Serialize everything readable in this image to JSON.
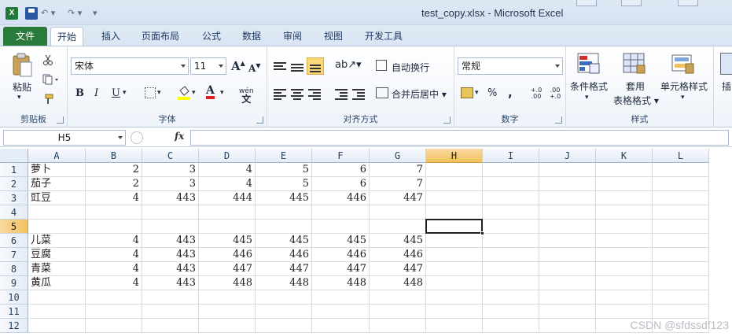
{
  "window": {
    "title": "test_copy.xlsx  -  Microsoft Excel"
  },
  "qat": {
    "undo": "↶ ▾",
    "redo": "↷ ▾",
    "customize": "▾"
  },
  "tabs": [
    {
      "label": "文件"
    },
    {
      "label": "开始"
    },
    {
      "label": "插入"
    },
    {
      "label": "页面布局"
    },
    {
      "label": "公式"
    },
    {
      "label": "数据"
    },
    {
      "label": "审阅"
    },
    {
      "label": "视图"
    },
    {
      "label": "开发工具"
    }
  ],
  "ribbon": {
    "clipboard": {
      "label": "剪贴板",
      "paste": "粘贴"
    },
    "font": {
      "label": "字体",
      "name": "宋体",
      "size": "11",
      "grow": "A",
      "shrink": "A",
      "bold": "B",
      "italic": "I",
      "underline": "U",
      "font_color": "A",
      "phonetic": "wén"
    },
    "alignment": {
      "label": "对齐方式",
      "wrap": "自动换行",
      "merge": "合并后居中"
    },
    "number": {
      "label": "数字",
      "format": "常规",
      "percent": "%",
      "comma": ",",
      "inc_decimal": "+.0 .00",
      "dec_decimal": ".00 +.0"
    },
    "styles": {
      "label": "样式",
      "cond_format": "条件格式",
      "table_format_1": "套用",
      "table_format_2": "表格格式",
      "cell_styles": "单元格样式",
      "insert_partial": "插"
    }
  },
  "formula_bar": {
    "name_box": "H5",
    "fx": "fx",
    "formula": ""
  },
  "sheet": {
    "columns": [
      "A",
      "B",
      "C",
      "D",
      "E",
      "F",
      "G",
      "H",
      "I",
      "J",
      "K",
      "L"
    ],
    "selected_column": "H",
    "selected_row": 5,
    "rows": [
      {
        "n": 1,
        "cells": [
          "萝卜",
          2,
          3,
          4,
          5,
          6,
          7
        ]
      },
      {
        "n": 2,
        "cells": [
          "茄子",
          2,
          3,
          4,
          5,
          6,
          7
        ]
      },
      {
        "n": 3,
        "cells": [
          "豇豆",
          4,
          443,
          444,
          445,
          446,
          447
        ]
      },
      {
        "n": 4,
        "cells": []
      },
      {
        "n": 5,
        "cells": []
      },
      {
        "n": 6,
        "cells": [
          "儿菜",
          4,
          443,
          445,
          445,
          445,
          445
        ]
      },
      {
        "n": 7,
        "cells": [
          "豆腐",
          4,
          443,
          446,
          446,
          446,
          446
        ]
      },
      {
        "n": 8,
        "cells": [
          "青菜",
          4,
          443,
          447,
          447,
          447,
          447
        ]
      },
      {
        "n": 9,
        "cells": [
          "黄瓜",
          4,
          443,
          448,
          448,
          448,
          448
        ]
      },
      {
        "n": 10,
        "cells": []
      },
      {
        "n": 11,
        "cells": []
      },
      {
        "n": 12,
        "cells": []
      }
    ]
  },
  "watermark": "CSDN @sfdssdf123"
}
